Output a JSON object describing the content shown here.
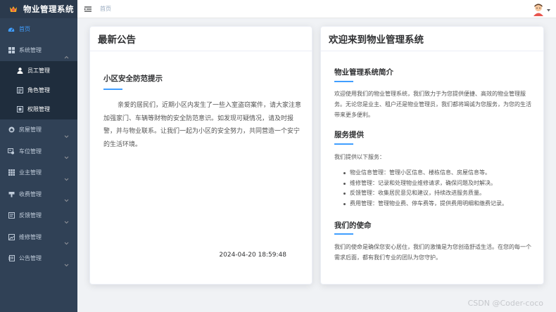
{
  "app": {
    "title": "物业管理系统"
  },
  "header": {
    "breadcrumb": "首页"
  },
  "sidebar": {
    "items": [
      {
        "label": "首页",
        "icon": "dashboard-icon"
      },
      {
        "label": "系统管理",
        "icon": "grid-icon"
      },
      {
        "label": "房屋管理",
        "icon": "house-icon"
      },
      {
        "label": "车位管理",
        "icon": "parking-icon"
      },
      {
        "label": "业主管理",
        "icon": "apps-icon"
      },
      {
        "label": "收费管理",
        "icon": "fee-icon"
      },
      {
        "label": "反馈管理",
        "icon": "feedback-icon"
      },
      {
        "label": "维修管理",
        "icon": "repair-icon"
      },
      {
        "label": "公告管理",
        "icon": "notice-icon"
      }
    ],
    "submenu": [
      {
        "label": "员工管理",
        "icon": "user-icon"
      },
      {
        "label": "角色管理",
        "icon": "role-icon"
      },
      {
        "label": "权限管理",
        "icon": "permission-icon"
      }
    ]
  },
  "notice_card": {
    "header": "最新公告",
    "title": "小区安全防范提示",
    "body": "亲爱的居民们，近期小区内发生了一些入室盗窃案件，请大家注意加强家门、车辆等财物的安全防范意识。如发现可疑情况，请及时报警，并与物业联系。让我们一起为小区的安全努力，共同营造一个安宁的生活环境。",
    "date": "2024-04-20 18:59:48"
  },
  "welcome_card": {
    "header": "欢迎来到物业管理系统",
    "intro_title": "物业管理系统简介",
    "intro_text": "欢迎使用我们的物业管理系统，我们致力于为您提供便捷、高效的物业管理服务。无论您是业主、租户还是物业管理员，我们都将竭诚为您服务，为您的生活带来更多便利。",
    "services_title": "服务提供",
    "services_intro": "我们提供以下服务：",
    "services": [
      "物业信息管理：管理小区信息、楼栋信息、房屋信息等。",
      "维修管理：记录和处理物业维修请求，确保问题及时解决。",
      "反馈管理：收集居民意见和建议，持续改进服务质量。",
      "费用管理：管理物业费、停车费等，提供费用明细和缴费记录。"
    ],
    "mission_title": "我们的使命",
    "mission_text": "我们的使命是确保您安心居住，我们的激情是为您创造舒适生活。在您的每一个需求后面，都有我们专业的团队为您守护。"
  },
  "watermark": "CSDN @Coder-coco",
  "colors": {
    "sidebar": "#304156",
    "submenu": "#1f2d3d",
    "accent": "#409eff",
    "menu_text": "#bfcbd9"
  }
}
